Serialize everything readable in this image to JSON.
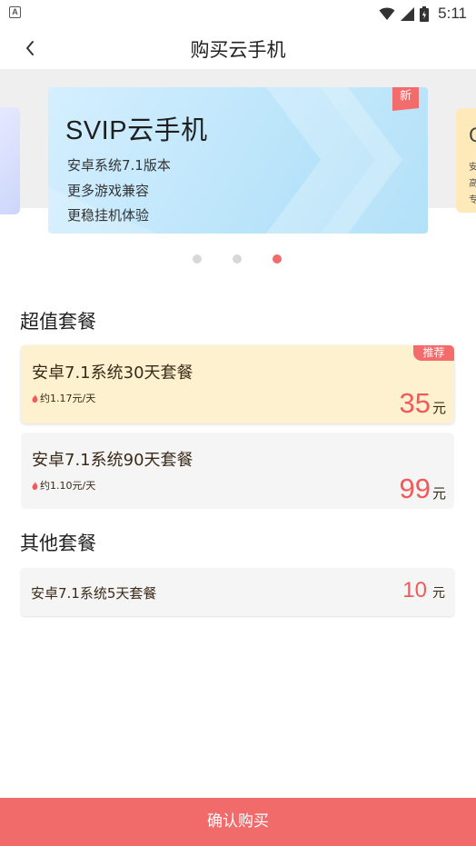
{
  "status_bar": {
    "app_icon_letter": "A",
    "time": "5:11",
    "icons": [
      "wifi-icon",
      "signal-icon",
      "battery-icon"
    ]
  },
  "header": {
    "back_icon": "chevron-left-icon",
    "title": "购买云手机"
  },
  "carousel": {
    "banner": {
      "badge": "新",
      "title": "SVIP云手机",
      "lines": [
        "安卓系统7.1版本",
        "更多游戏兼容",
        "更稳挂机体验"
      ]
    },
    "next_banner_peek": {
      "title": "G",
      "lines": [
        "安",
        "高",
        "专"
      ]
    },
    "dot_count": 3,
    "active_dot": 2
  },
  "sections": {
    "premium_title": "超值套餐",
    "other_title": "其他套餐"
  },
  "plans": [
    {
      "name": "安卓7.1系统30天套餐",
      "daily": "约1.17元/天",
      "price": "35",
      "unit": "元",
      "tag": "推荐",
      "selected": true
    },
    {
      "name": "安卓7.1系统90天套餐",
      "daily": "约1.10元/天",
      "price": "99",
      "unit": "元",
      "tag": "",
      "selected": false
    }
  ],
  "other_plans": [
    {
      "name": "安卓7.1系统5天套餐",
      "price": "10",
      "unit": "元"
    }
  ],
  "confirm_button": "确认购买",
  "colors": {
    "accent": "#f26b6b",
    "price": "#f05a5a",
    "selected_bg": "#fdf1cf",
    "card_bg": "#f5f5f5",
    "banner_bg": "#bfe6fb"
  }
}
